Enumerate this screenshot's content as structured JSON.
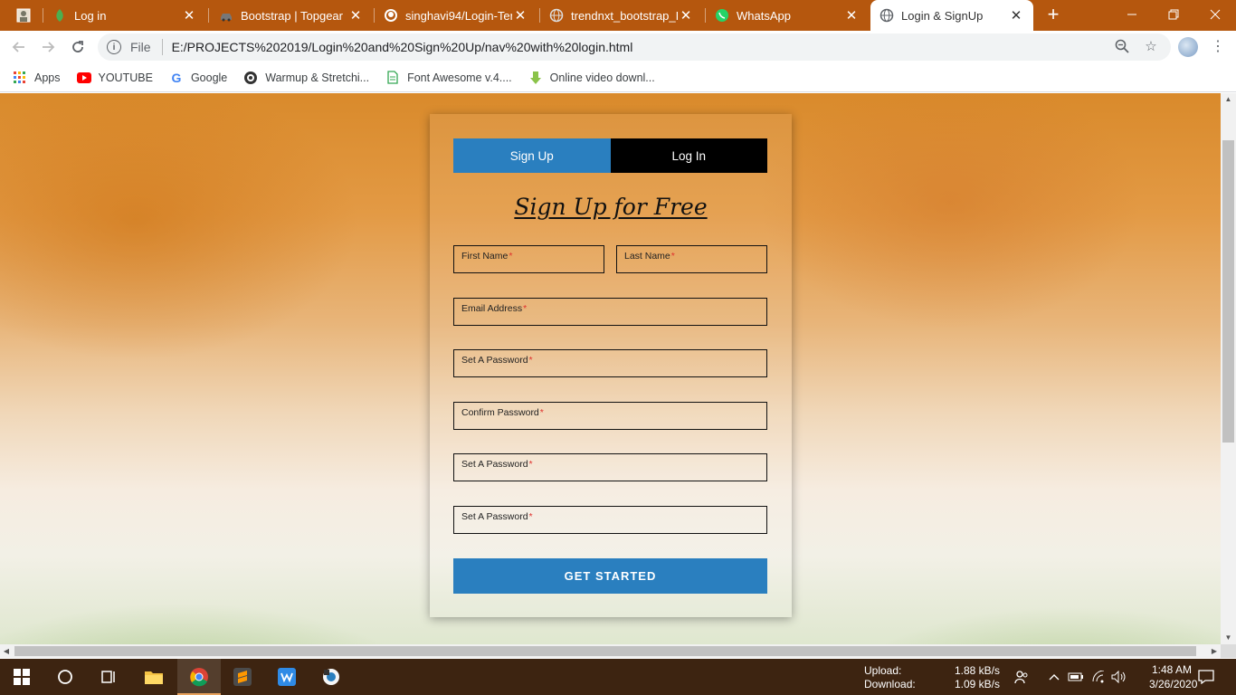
{
  "browser": {
    "tabs": [
      {
        "title": "",
        "icon": "profile-photo-icon"
      },
      {
        "title": "Log in",
        "icon": "leaf-icon"
      },
      {
        "title": "Bootstrap | Topgear",
        "icon": "car-icon"
      },
      {
        "title": "singhavi94/Login-Tem",
        "icon": "github-icon"
      },
      {
        "title": "trendnxt_bootstrap_I1",
        "icon": "globe-icon"
      },
      {
        "title": "WhatsApp",
        "icon": "whatsapp-icon"
      },
      {
        "title": "Login & SignUp",
        "icon": "globe-icon",
        "active": true
      }
    ],
    "address": {
      "scheme": "File",
      "url": "E:/PROJECTS%202019/Login%20and%20Sign%20Up/nav%20with%20login.html"
    },
    "bookmarks": [
      {
        "label": "Apps",
        "icon": "apps-grid-icon"
      },
      {
        "label": "YOUTUBE",
        "icon": "youtube-icon"
      },
      {
        "label": "Google",
        "icon": "google-icon"
      },
      {
        "label": "Warmup & Stretchi...",
        "icon": "warmup-icon"
      },
      {
        "label": "Font Awesome v.4....",
        "icon": "document-icon"
      },
      {
        "label": "Online video downl...",
        "icon": "download-icon"
      }
    ]
  },
  "form": {
    "tabs": {
      "signup": "Sign Up",
      "login": "Log In"
    },
    "heading": "Sign Up for Free",
    "required_mark": "*",
    "fields": [
      {
        "label": "First Name"
      },
      {
        "label": "Last Name"
      },
      {
        "label": "Email Address"
      },
      {
        "label": "Set A Password"
      },
      {
        "label": "Confirm Password"
      },
      {
        "label": "Set A Password"
      },
      {
        "label": "Set A Password"
      }
    ],
    "submit": "GET STARTED"
  },
  "taskbar": {
    "network": {
      "upload_label": "Upload:",
      "upload_value": "1.88 kB/s",
      "download_label": "Download:",
      "download_value": "1.09 kB/s"
    },
    "time": "1:48 AM",
    "date": "3/26/2020"
  },
  "colors": {
    "accent": "#2a7fbf",
    "tabstrip": "#b5570e",
    "taskbar": "#3d2411",
    "required": "#e0322e"
  }
}
